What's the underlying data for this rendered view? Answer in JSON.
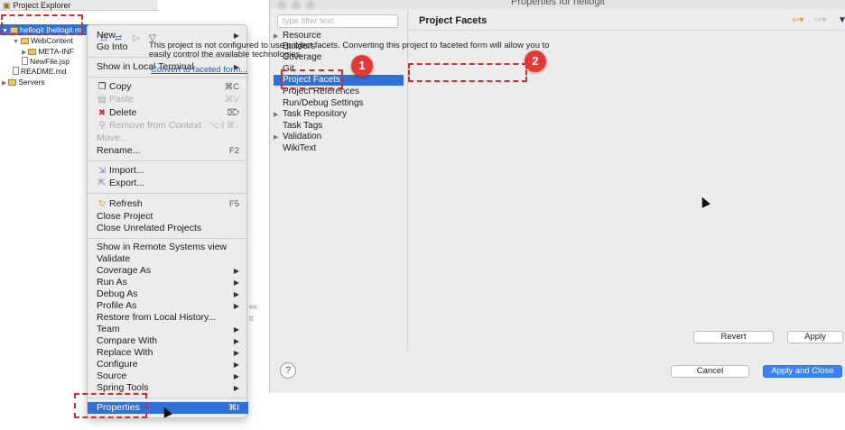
{
  "explorer": {
    "title": "Project Explorer",
    "tree": {
      "hellogit": "hellogit [hellogit m...",
      "webcontent": "WebContent",
      "metainf": "META-INF",
      "newfile": "NewFile.jsp",
      "readme": "README.md",
      "servers": "Servers"
    }
  },
  "context_menu": {
    "items": {
      "new": {
        "label": "New"
      },
      "go_into": {
        "label": "Go Into"
      },
      "show_terminal": {
        "label": "Show in Local Terminal"
      },
      "copy": {
        "label": "Copy",
        "shortcut": "⌘C"
      },
      "paste": {
        "label": "Paste",
        "shortcut": "⌘V"
      },
      "delete": {
        "label": "Delete",
        "shortcut": "⌦"
      },
      "remove_context": {
        "label": "Remove from Context",
        "shortcut": "⌥⇧⌘↓"
      },
      "move": {
        "label": "Move..."
      },
      "rename": {
        "label": "Rename...",
        "shortcut": "F2"
      },
      "import": {
        "label": "Import..."
      },
      "export": {
        "label": "Export..."
      },
      "refresh": {
        "label": "Refresh",
        "shortcut": "F5"
      },
      "close_project": {
        "label": "Close Project"
      },
      "close_unrelated": {
        "label": "Close Unrelated Projects"
      },
      "show_remote": {
        "label": "Show in Remote Systems view"
      },
      "validate": {
        "label": "Validate"
      },
      "coverage_as": {
        "label": "Coverage As"
      },
      "run_as": {
        "label": "Run As"
      },
      "debug_as": {
        "label": "Debug As"
      },
      "profile_as": {
        "label": "Profile As"
      },
      "restore_history": {
        "label": "Restore from Local History..."
      },
      "team": {
        "label": "Team"
      },
      "compare_with": {
        "label": "Compare With"
      },
      "replace_with": {
        "label": "Replace With"
      },
      "configure": {
        "label": "Configure"
      },
      "source": {
        "label": "Source"
      },
      "spring_tools": {
        "label": "Spring Tools"
      },
      "properties": {
        "label": "Properties",
        "shortcut": "⌘I"
      }
    }
  },
  "dialog": {
    "title": "Properties for hellogit",
    "filter_placeholder": "type filter text",
    "tree": {
      "resource": "Resource",
      "builders": "Builders",
      "coverage": "Coverage",
      "git": "Git",
      "project_facets": "Project Facets",
      "project_references": "Project References",
      "run_debug": "Run/Debug Settings",
      "task_repository": "Task Repository",
      "task_tags": "Task Tags",
      "validation": "Validation",
      "wikitext": "WikiText"
    },
    "page": {
      "title": "Project Facets",
      "description": "This project is not configured to use project facets. Converting this project to faceted form will allow you to easily control the available technologies.",
      "link": "Convert to faceted form..."
    },
    "buttons": {
      "revert": "Revert",
      "apply": "Apply",
      "cancel": "Cancel",
      "apply_close": "Apply and Close",
      "help": "?"
    }
  },
  "callouts": {
    "step1": "1",
    "step2": "2"
  },
  "colors": {
    "selection": "#2f6fd6",
    "callout": "#e53935",
    "link": "#1f5fc8"
  }
}
